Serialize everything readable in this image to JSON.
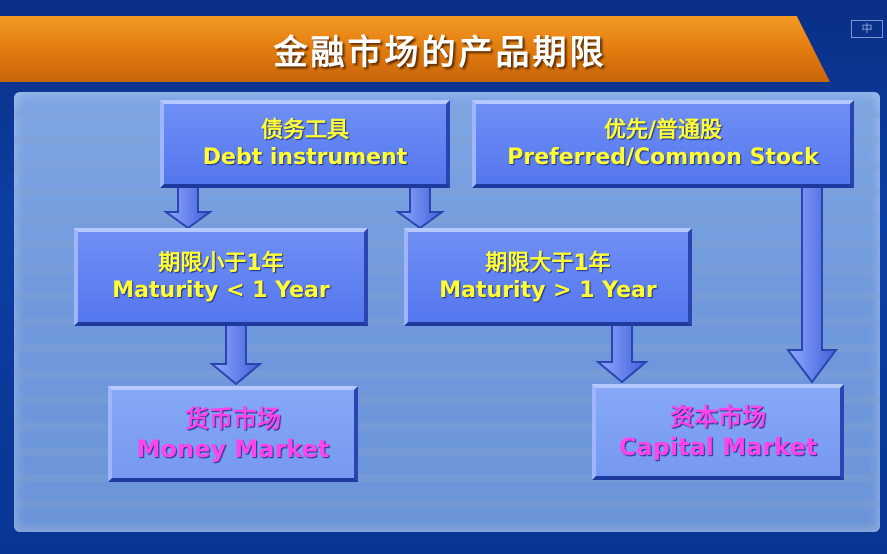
{
  "title": "金融市场的产品期限",
  "corner_logo": "中",
  "boxes": {
    "debt": {
      "cn": "债务工具",
      "en": "Debt instrument"
    },
    "stock": {
      "cn": "优先/普通股",
      "en": "Preferred/Common Stock"
    },
    "short": {
      "cn": "期限小于1年",
      "en": "Maturity < 1 Year"
    },
    "long": {
      "cn": "期限大于1年",
      "en": "Maturity > 1 Year"
    },
    "money": {
      "cn": "货币市场",
      "en": "Money Market"
    },
    "capital": {
      "cn": "资本市场",
      "en": "Capital Market"
    }
  },
  "colors": {
    "title_bar": "#e88318",
    "box_fill": "#5b7ef0",
    "text_yellow": "#ffff33",
    "text_magenta": "#ff44ee",
    "arrow": "#5b7ef0"
  }
}
